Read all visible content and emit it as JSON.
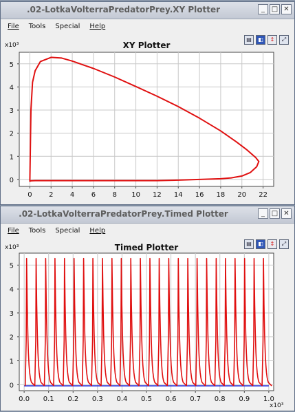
{
  "windows": [
    {
      "title": ".02-LotkaVolterraPredatorPrey.XY Plotter",
      "menu": {
        "file": "File",
        "tools": "Tools",
        "special": "Special",
        "help": "Help"
      },
      "controls": {
        "minimize": "_",
        "maximize": "□",
        "close": "✕"
      },
      "toolbar_icons": [
        "print-icon",
        "reset-axes-icon",
        "legend-icon",
        "fill-icon"
      ],
      "chart_data": {
        "type": "line",
        "title": "XY Plotter",
        "x_multiplier": "x10³",
        "y_multiplier": "x10³",
        "xlim": [
          -1,
          23
        ],
        "ylim": [
          -0.3,
          5.5
        ],
        "x_ticks": [
          "0",
          "2",
          "4",
          "6",
          "8",
          "10",
          "12",
          "14",
          "16",
          "18",
          "20",
          "22"
        ],
        "y_ticks": [
          "0",
          "1",
          "2",
          "3",
          "4",
          "5"
        ],
        "grid": true,
        "series": [
          {
            "color": "#e01010",
            "x": [
              0.0,
              0.1,
              0.25,
              0.5,
              1.0,
              2.0,
              3.0,
              4.0,
              6.0,
              8.0,
              10.0,
              12.0,
              14.0,
              16.0,
              18.0,
              19.5,
              20.5,
              21.3,
              21.6,
              21.4,
              20.8,
              20.0,
              19.0,
              18.0,
              16.0,
              14.0,
              12.0,
              10.5,
              8.0,
              5.0,
              2.0,
              0.5,
              0.1,
              0.0,
              0.0
            ],
            "y": [
              -0.1,
              3.0,
              4.2,
              4.7,
              5.1,
              5.28,
              5.25,
              5.12,
              4.8,
              4.43,
              4.02,
              3.6,
              3.15,
              2.65,
              2.1,
              1.62,
              1.27,
              0.95,
              0.78,
              0.55,
              0.3,
              0.15,
              0.07,
              0.03,
              0.0,
              -0.03,
              -0.05,
              -0.05,
              -0.05,
              -0.05,
              -0.05,
              -0.05,
              -0.06,
              -0.08,
              -0.1
            ]
          }
        ]
      }
    },
    {
      "title": ".02-LotkaVolterraPredatorPrey.Timed Plotter",
      "menu": {
        "file": "File",
        "tools": "Tools",
        "special": "Special",
        "help": "Help"
      },
      "controls": {
        "minimize": "_",
        "maximize": "□",
        "close": "✕"
      },
      "toolbar_icons": [
        "print-icon",
        "reset-axes-icon",
        "legend-icon",
        "fill-icon"
      ],
      "chart_data": {
        "type": "line",
        "title": "Timed Plotter",
        "x_multiplier": "x10³",
        "y_multiplier": "x10³",
        "xlim": [
          -0.02,
          1.02
        ],
        "ylim": [
          -0.25,
          5.5
        ],
        "x_ticks": [
          "0.0",
          "0.1",
          "0.2",
          "0.3",
          "0.4",
          "0.5",
          "0.6",
          "0.7",
          "0.8",
          "0.9",
          "1.0"
        ],
        "y_ticks": [
          "0",
          "1",
          "2",
          "3",
          "4",
          "5"
        ],
        "grid": true,
        "peak_times": [
          0.01,
          0.049,
          0.088,
          0.126,
          0.165,
          0.204,
          0.243,
          0.281,
          0.32,
          0.359,
          0.397,
          0.436,
          0.475,
          0.514,
          0.552,
          0.591,
          0.63,
          0.669,
          0.707,
          0.746,
          0.785,
          0.823,
          0.862,
          0.901,
          0.94,
          0.978
        ],
        "peak_value": 5.28,
        "baseline": -0.05,
        "series_colors": [
          "#e01010",
          "#1d2bd8"
        ]
      }
    }
  ]
}
